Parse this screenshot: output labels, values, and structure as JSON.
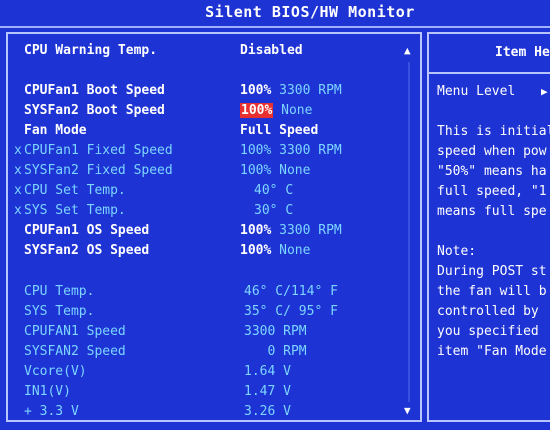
{
  "title": "Silent BIOS/HW Monitor",
  "settings": [
    {
      "mark": "",
      "label": "CPU Warning Temp.",
      "label_color": "white",
      "value": "Disabled",
      "value_color": "white"
    },
    {
      "mark": "",
      "label": "CPUFan1 Boot Speed",
      "label_color": "white",
      "num": "100%",
      "num_hl": false,
      "unit": "3300 RPM"
    },
    {
      "mark": "",
      "label": "SYSFan2 Boot Speed",
      "label_color": "white",
      "num": "100%",
      "num_hl": true,
      "unit": "None"
    },
    {
      "mark": "",
      "label": "Fan Mode",
      "label_color": "white",
      "value": "Full Speed",
      "value_color": "white"
    },
    {
      "mark": "x",
      "label": "CPUFan1 Fixed Speed",
      "label_color": "cyan",
      "num": "100%",
      "num_hl": false,
      "unit": "3300 RPM",
      "dim": true
    },
    {
      "mark": "x",
      "label": "SYSFan2 Fixed Speed",
      "label_color": "cyan",
      "num": "100%",
      "num_hl": false,
      "unit": "None",
      "dim": true
    },
    {
      "mark": "x",
      "label": "CPU Set Temp.",
      "label_color": "cyan",
      "num": "40°",
      "num_hl": false,
      "unit": "C",
      "dim": true,
      "indent": true
    },
    {
      "mark": "x",
      "label": "SYS Set Temp.",
      "label_color": "cyan",
      "num": "30°",
      "num_hl": false,
      "unit": "C",
      "dim": true,
      "indent": true
    },
    {
      "mark": "",
      "label": "CPUFan1 OS Speed",
      "label_color": "white",
      "num": "100%",
      "num_hl": false,
      "unit": "3300 RPM"
    },
    {
      "mark": "",
      "label": "SYSFan2 OS Speed",
      "label_color": "white",
      "num": "100%",
      "num_hl": false,
      "unit": "None"
    }
  ],
  "monitor": [
    {
      "label": "CPU Temp.",
      "value": "46° C/114° F"
    },
    {
      "label": "SYS Temp.",
      "value": "35° C/ 95° F"
    },
    {
      "label": "CPUFAN1 Speed",
      "value": "3300 RPM"
    },
    {
      "label": "SYSFAN2 Speed",
      "value": "   0 RPM"
    },
    {
      "label": "Vcore(V)",
      "value": "1.64 V"
    },
    {
      "label": "IN1(V)",
      "value": "1.47 V"
    },
    {
      "label": "+ 3.3 V",
      "value": "3.26 V"
    }
  ],
  "help": {
    "title": "Item Help",
    "menu_level": "Menu Level",
    "lines": [
      "This is initial",
      "speed when pow",
      "\"50%\" means ha",
      "full speed, \"1",
      "means full spe",
      "",
      "Note:",
      "During POST st",
      "the fan will b",
      "controlled by",
      "you specified",
      "item \"Fan Mode"
    ]
  },
  "scroll": {
    "up": "▲",
    "down": "▼"
  },
  "help_arrow": "▶"
}
